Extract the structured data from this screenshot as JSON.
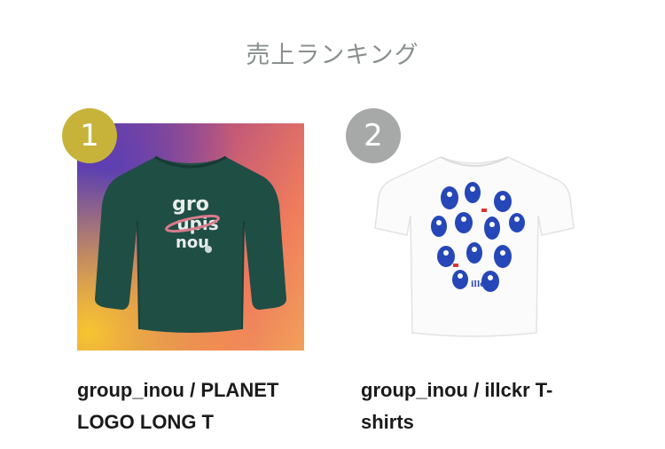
{
  "section": {
    "title": "売上ランキング"
  },
  "ranking": [
    {
      "rank": "1",
      "name": "group_inou / PLANET LOGO LONG T",
      "badge_color": "#c8b33a"
    },
    {
      "rank": "2",
      "name": "group_inou / illckr T-shirts",
      "badge_color": "#a7a9a9"
    }
  ]
}
